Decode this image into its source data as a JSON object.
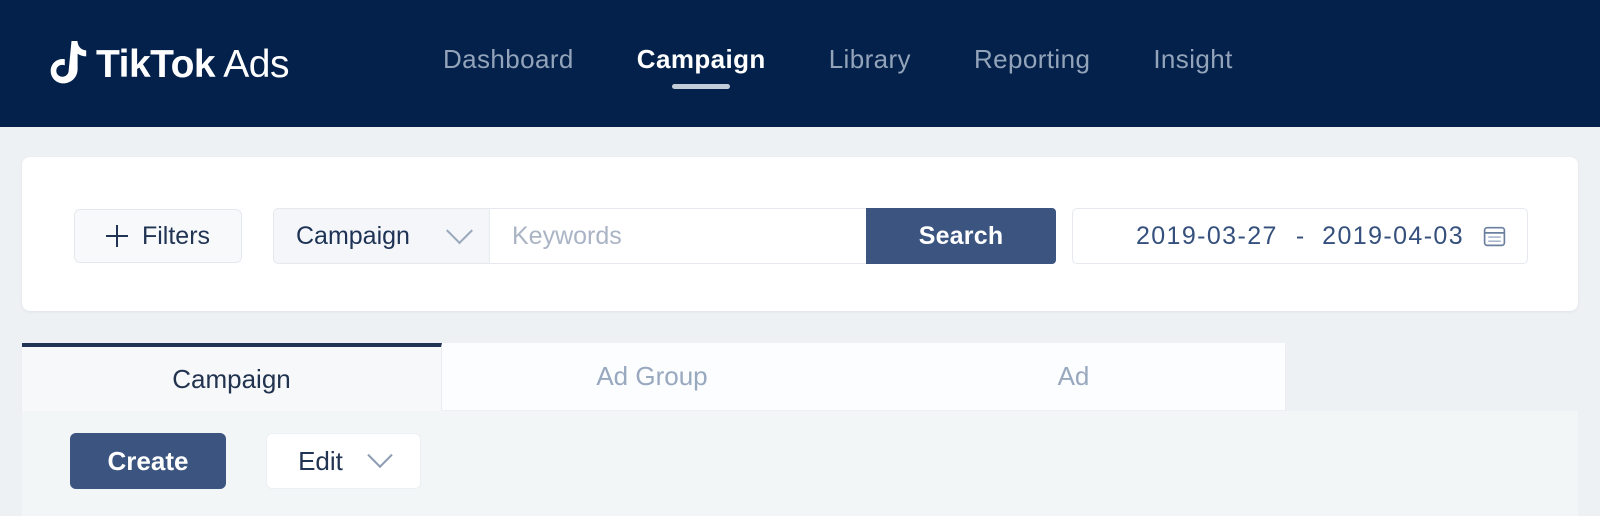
{
  "header": {
    "brand": {
      "name_bold": "TikTok",
      "name_light": "Ads",
      "logo_icon": "tiktok-note-icon"
    },
    "nav": [
      {
        "label": "Dashboard",
        "active": false
      },
      {
        "label": "Campaign",
        "active": true
      },
      {
        "label": "Library",
        "active": false
      },
      {
        "label": "Reporting",
        "active": false
      },
      {
        "label": "Insight",
        "active": false
      }
    ],
    "background_color": "#03214a"
  },
  "filters": {
    "filters_button": {
      "label": "Filters",
      "icon": "plus-icon"
    },
    "type_select": {
      "value": "Campaign",
      "icon": "chevron-down-icon"
    },
    "keywords": {
      "placeholder": "Keywords",
      "value": ""
    },
    "search_button": {
      "label": "Search",
      "color": "#3b5580"
    },
    "date_range": {
      "start": "2019-03-27",
      "separator": "-",
      "end": "2019-04-03",
      "icon": "calendar-icon"
    }
  },
  "tabs": [
    {
      "label": "Campaign",
      "active": true
    },
    {
      "label": "Ad Group",
      "active": false
    },
    {
      "label": "Ad",
      "active": false
    }
  ],
  "actions": {
    "create_button": {
      "label": "Create",
      "color": "#3b5580"
    },
    "edit_button": {
      "label": "Edit",
      "icon": "chevron-down-icon"
    }
  }
}
